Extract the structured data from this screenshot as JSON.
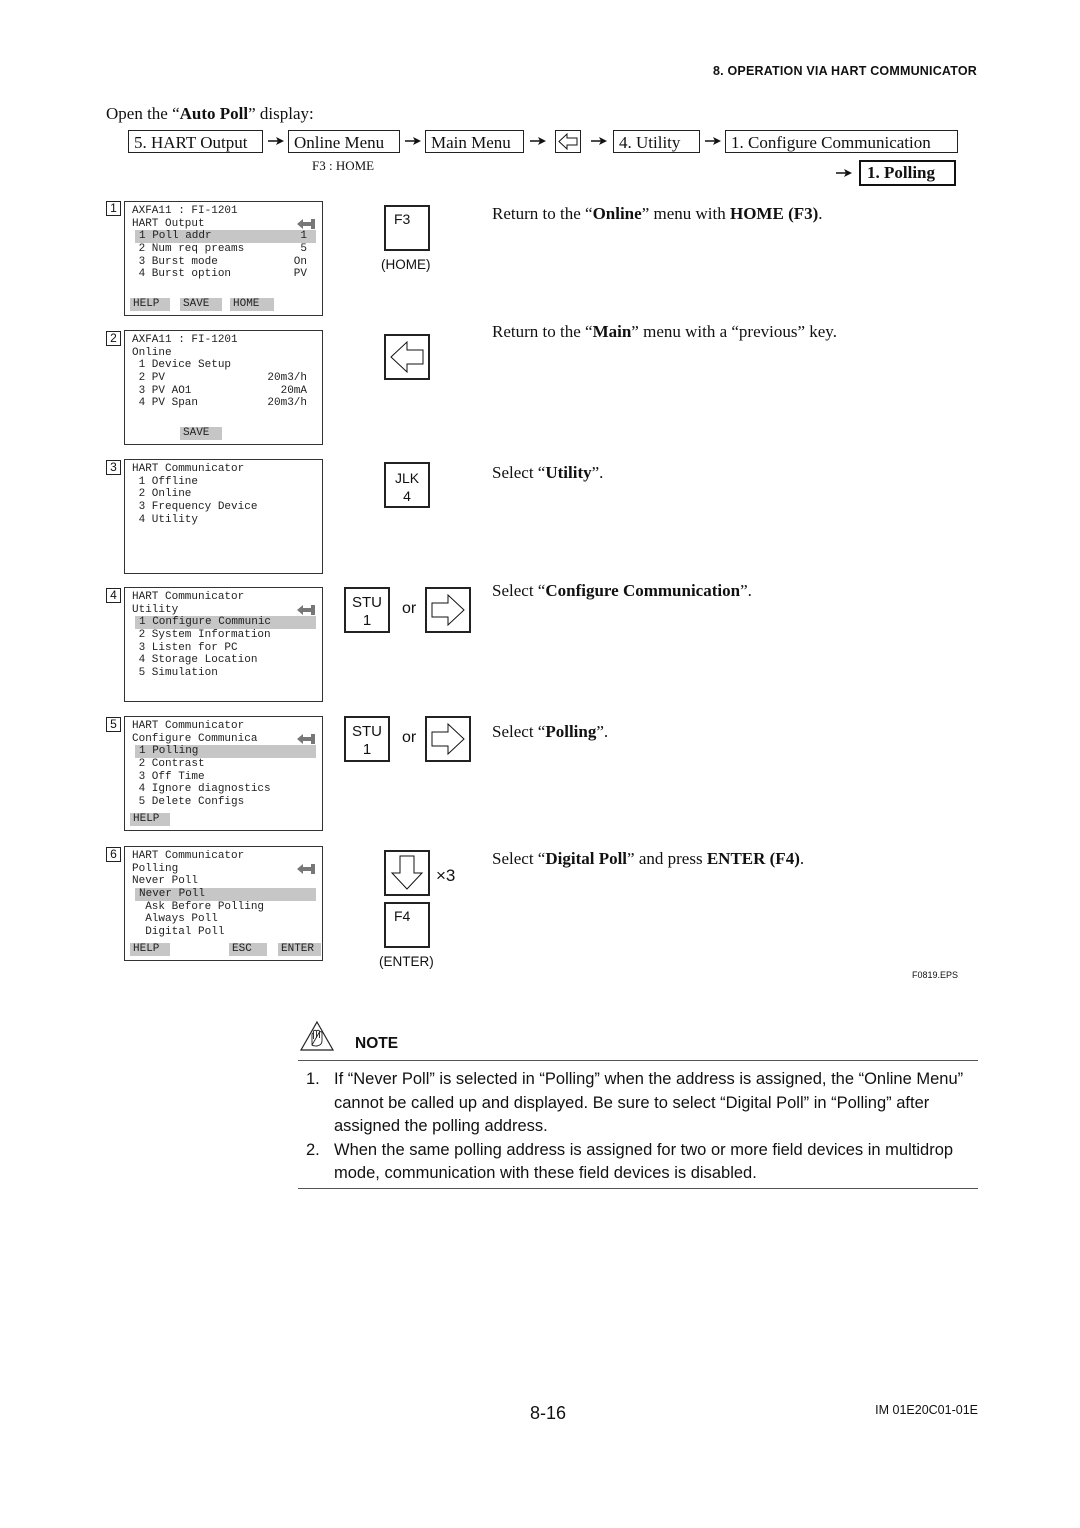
{
  "header": {
    "section_title": "8. OPERATION VIA HART COMMUNICATOR"
  },
  "intro": {
    "prefix": "Open the “",
    "bold": "Auto Poll",
    "suffix": "” display:"
  },
  "breadcrumb": {
    "items": [
      "5.  HART Output",
      "Online Menu",
      "Main Menu",
      "previous-key",
      "4.  Utility",
      "1.  Configure Communication"
    ],
    "sub_label": "F3 : HOME",
    "final": "1.  Polling"
  },
  "steps": [
    {
      "num": "1",
      "lcd": {
        "lines": [
          {
            "text": "AXFA11 : FI-1201",
            "value": ""
          },
          {
            "text": "HART Output",
            "value": "",
            "back": true
          },
          {
            "text": "1 Poll addr",
            "value": "1",
            "selected": true
          },
          {
            "text": " 2 Num req preams",
            "value": "5"
          },
          {
            "text": " 3 Burst mode",
            "value": "On"
          },
          {
            "text": " 4 Burst option",
            "value": "PV"
          }
        ],
        "fkeys": [
          "HELP",
          "SAVE",
          "HOME"
        ]
      },
      "key": {
        "top": "F3",
        "caption": "(HOME)"
      },
      "instruction": {
        "parts": [
          "Return to the “",
          "Online",
          "” menu with ",
          "HOME (F3)",
          "."
        ]
      }
    },
    {
      "num": "2",
      "lcd": {
        "lines": [
          {
            "text": "AXFA11 : FI-1201",
            "value": ""
          },
          {
            "text": "Online",
            "value": ""
          },
          {
            "text": " 1 Device Setup",
            "value": ""
          },
          {
            "text": " 2 PV",
            "value": "20m3/h"
          },
          {
            "text": " 3 PV AO1",
            "value": "20mA"
          },
          {
            "text": " 4 PV Span",
            "value": "20m3/h"
          }
        ],
        "fkeys": [
          "SAVE"
        ]
      },
      "key": {
        "icon": "left-arrow"
      },
      "instruction": {
        "parts": [
          "Return to the “",
          "Main",
          "” menu with a “previous” key."
        ]
      }
    },
    {
      "num": "3",
      "lcd": {
        "lines": [
          {
            "text": "HART Communicator",
            "value": ""
          },
          {
            "text": " 1 Offline",
            "value": ""
          },
          {
            "text": " 2 Online",
            "value": ""
          },
          {
            "text": " 3 Frequency Device",
            "value": ""
          },
          {
            "text": " 4 Utility",
            "value": ""
          }
        ],
        "fkeys": []
      },
      "key": {
        "line1": "JLK",
        "line2": "4"
      },
      "instruction": {
        "parts": [
          "Select “",
          "Utility",
          "”."
        ]
      }
    },
    {
      "num": "4",
      "lcd": {
        "lines": [
          {
            "text": "HART Communicator",
            "value": ""
          },
          {
            "text": "Utility",
            "value": "",
            "back": true
          },
          {
            "text": "1 Configure Communic",
            "value": "",
            "selected": true
          },
          {
            "text": " 2 System Information",
            "value": ""
          },
          {
            "text": " 3 Listen for PC",
            "value": ""
          },
          {
            "text": " 4 Storage Location",
            "value": ""
          },
          {
            "text": " 5 Simulation",
            "value": ""
          }
        ],
        "fkeys": []
      },
      "key": {
        "line1": "STU",
        "line2": "1",
        "or": "or",
        "alt_icon": "right-arrow"
      },
      "instruction": {
        "parts": [
          "Select “",
          "Configure Communication",
          "”."
        ]
      }
    },
    {
      "num": "5",
      "lcd": {
        "lines": [
          {
            "text": "HART Communicator",
            "value": ""
          },
          {
            "text": "Configure Communica",
            "value": "",
            "back": true
          },
          {
            "text": "1 Polling",
            "value": "",
            "selected": true
          },
          {
            "text": " 2 Contrast",
            "value": ""
          },
          {
            "text": " 3 Off Time",
            "value": ""
          },
          {
            "text": " 4 Ignore diagnostics",
            "value": ""
          },
          {
            "text": " 5 Delete Configs",
            "value": ""
          }
        ],
        "fkeys": [
          "HELP"
        ]
      },
      "key": {
        "line1": "STU",
        "line2": "1",
        "or": "or",
        "alt_icon": "right-arrow"
      },
      "instruction": {
        "parts": [
          "Select “",
          "Polling",
          "”."
        ]
      }
    },
    {
      "num": "6",
      "lcd": {
        "lines": [
          {
            "text": "HART Communicator",
            "value": ""
          },
          {
            "text": "Polling",
            "value": "",
            "back": true
          },
          {
            "text": "Never Poll",
            "value": ""
          },
          {
            "text": "Never Poll",
            "value": "",
            "selected": true
          },
          {
            "text": "  Ask Before Polling",
            "value": ""
          },
          {
            "text": "  Always Poll",
            "value": ""
          },
          {
            "text": "  Digital Poll",
            "value": ""
          }
        ],
        "fkeys": [
          "HELP",
          "ESC",
          "ENTER"
        ]
      },
      "key": {
        "icon": "down-arrow",
        "repeat": "×3",
        "top": "F4",
        "caption": "(ENTER)"
      },
      "instruction": {
        "parts": [
          "Select “",
          "Digital Poll",
          "” and press ",
          "ENTER (F4)",
          "."
        ]
      }
    }
  ],
  "figure_id": "F0819.EPS",
  "note": {
    "title": "NOTE",
    "items": [
      {
        "num": "1.",
        "text": "If “Never Poll” is selected in “Polling” when the address is assigned, the “Online Menu” cannot be called up and displayed. Be sure to select “Digital Poll” in “Polling” after assigned the polling address."
      },
      {
        "num": "2.",
        "text": "When the same polling address is assigned for two or more field devices in multidrop mode, communication with these field devices is disabled."
      }
    ]
  },
  "footer": {
    "page_number": "8-16",
    "doc_id": "IM 01E20C01-01E"
  }
}
